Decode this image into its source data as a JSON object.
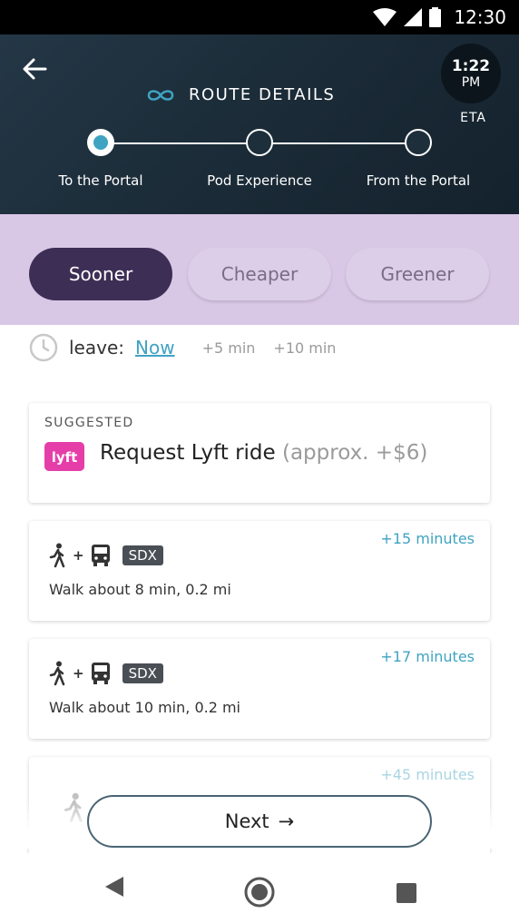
{
  "status_bar": {
    "time": "12:30"
  },
  "header": {
    "title": "ROUTE DETAILS",
    "eta_time": "1:22",
    "eta_ampm": "PM",
    "eta_label": "ETA",
    "steps": [
      {
        "label": "To the Portal"
      },
      {
        "label": "Pod Experience"
      },
      {
        "label": "From the Portal"
      }
    ]
  },
  "filters": {
    "sooner": "Sooner",
    "cheaper": "Cheaper",
    "greener": "Greener"
  },
  "leave": {
    "label": "leave:",
    "now": "Now",
    "plus5": "+5 min",
    "plus10": "+10 min"
  },
  "suggested": {
    "label": "SUGGESTED",
    "badge": "lyft",
    "text": "Request Lyft ride",
    "approx": "(approx. +$6)"
  },
  "routes": [
    {
      "extra": "+15 minutes",
      "plus": "+",
      "badge": "SDX",
      "desc": "Walk about 8 min, 0.2 mi"
    },
    {
      "extra": "+17 minutes",
      "plus": "+",
      "badge": "SDX",
      "desc": "Walk about 10 min, 0.2 mi"
    },
    {
      "extra": "+45 minutes"
    }
  ],
  "next_button": {
    "label": "Next",
    "arrow": "→"
  },
  "colors": {
    "accent": "#3fa3c2",
    "header_bg": "#1e2f3c",
    "filter_band": "#d9c7e6",
    "active_pill": "#3d2e55",
    "lyft_pink": "#e63ea9"
  }
}
